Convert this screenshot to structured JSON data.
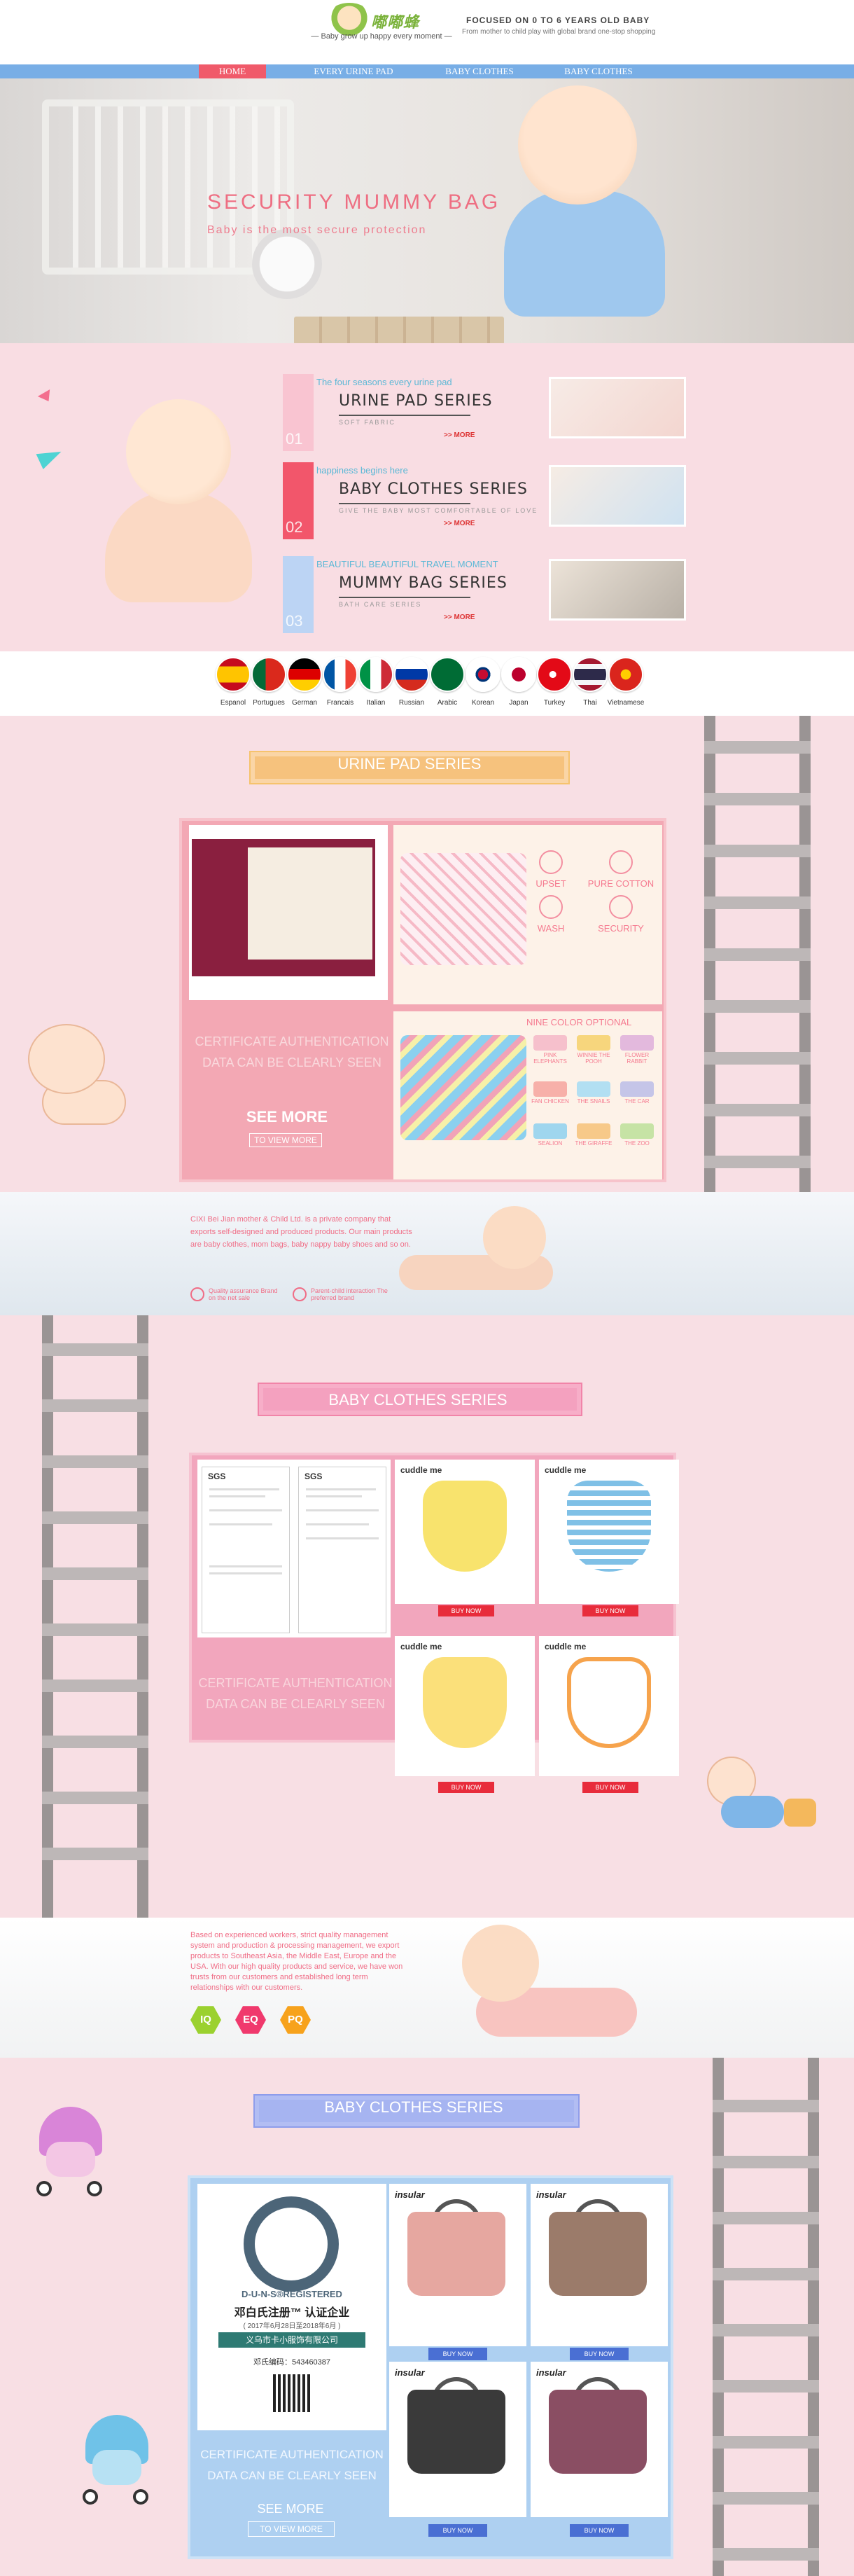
{
  "header": {
    "logo_text": "嘟嘟蜂",
    "tagline": "— Baby grow up happy every moment —",
    "title": "FOCUSED ON 0 TO 6 YEARS OLD BABY",
    "subtitle": "From mother to child play with global brand one-stop shopping"
  },
  "nav": {
    "items": [
      "HOME",
      "EVERY URINE PAD",
      "BABY CLOTHES",
      "BABY CLOTHES"
    ]
  },
  "hero": {
    "title": "SECURITY MUMMY BAG",
    "subtitle": "Baby is the most secure protection"
  },
  "series": [
    {
      "num": "01",
      "tag": "The four seasons every urine pad",
      "name": "URINE PAD SERIES",
      "sub": "SOFT FABRIC",
      "more": "MORE",
      "color": "#f9c4d1",
      "tag_color": "#5bb8d6"
    },
    {
      "num": "02",
      "tag": "happiness begins here",
      "name": "BABY CLOTHES SERIES",
      "sub": "GIVE THE BABY MOST COMFORTABLE OF LOVE",
      "more": "MORE",
      "color": "#f2566b",
      "tag_color": "#5bb8d6"
    },
    {
      "num": "03",
      "tag": "BEAUTIFUL BEAUTIFUL TRAVEL MOMENT",
      "name": "MUMMY BAG SERIES",
      "sub": "BATH CARE SERIES",
      "more": "MORE",
      "color": "#bcd4f4",
      "tag_color": "#5bb8d6"
    }
  ],
  "languages": [
    "Espanol",
    "Portugues",
    "German",
    "Francais",
    "Italian",
    "Russian",
    "Arabic",
    "Korean",
    "Japan",
    "Turkey",
    "Thai",
    "Vietnamese"
  ],
  "urine": {
    "ribbon_title": "URINE PAD SERIES",
    "cert_text": "CERTIFICATE AUTHENTICATION DATA CAN BE CLEARLY SEEN",
    "see_more": "SEE MORE",
    "to_view": "TO VIEW MORE",
    "features": [
      "UPSET",
      "PURE COTTON",
      "WASH",
      "SECURITY"
    ],
    "nine_title": "NINE COLOR OPTIONAL",
    "swatches": [
      "PINK ELEPHANTS",
      "WINNIE THE POOH",
      "FLOWER RABBIT",
      "FAN CHICKEN",
      "THE SNAILS",
      "THE CAR",
      "SEALION",
      "THE GIRAFFE",
      "THE ZOO"
    ]
  },
  "about1": {
    "text": "CIXI Bei Jian mother & Child Ltd. is a private company that exports self-designed and produced products. Our main products are baby clothes, mom bags, baby nappy baby shoes and so on.",
    "icons": [
      "Quality assurance Brand on the net sale",
      "Parent-child interaction The preferred brand"
    ]
  },
  "clothes": {
    "ribbon_title": "BABY CLOTHES SERIES",
    "cert_text": "CERTIFICATE AUTHENTICATION DATA CAN BE CLEARLY SEEN",
    "cert_brand": "SGS",
    "products": [
      {
        "brand": "cuddle me",
        "buy": "BUY NOW",
        "color": "#f8e36d"
      },
      {
        "brand": "cuddle me",
        "buy": "BUY NOW",
        "color": "#7fc0e6"
      },
      {
        "brand": "cuddle me",
        "buy": "BUY NOW",
        "color": "#fbe07a"
      },
      {
        "brand": "cuddle me",
        "buy": "BUY NOW",
        "color": "#f6a34c"
      }
    ]
  },
  "about2": {
    "text": "Based on experienced workers, strict quality management system and production & processing management, we export products to Southeast Asia, the Middle East, Europe and the USA. With our high quality products and service, we have won trusts from our customers and established long term relationships with our customers.",
    "badges": [
      "IQ",
      "EQ",
      "PQ"
    ]
  },
  "bag": {
    "ribbon_title": "BABY CLOTHES SERIES",
    "dun_label": "D-U-N-S®REGISTERED",
    "dun_title": "邓白氏注册™ 认证企业",
    "dun_date": "( 2017年6月28日至2018年6月 )",
    "dun_company": "义乌市卡小服饰有限公司",
    "dun_code": "邓氏编码：543460387",
    "cert_text": "CERTIFICATE AUTHENTICATION DATA CAN BE CLEARLY SEEN",
    "see_more": "SEE MORE",
    "to_view": "TO VIEW MORE",
    "products": [
      {
        "brand": "insular",
        "buy": "BUY NOW",
        "color": "#e6a7a0"
      },
      {
        "brand": "insular",
        "buy": "BUY NOW",
        "color": "#9b7b6a"
      },
      {
        "brand": "insular",
        "buy": "BUY NOW",
        "color": "#3a3a3a"
      },
      {
        "brand": "insular",
        "buy": "BUY NOW",
        "color": "#8a4e63"
      }
    ]
  },
  "colors": {
    "pink_accent": "#f06d86",
    "nav_blue": "#78aee6",
    "home_red": "#f05a6a"
  }
}
